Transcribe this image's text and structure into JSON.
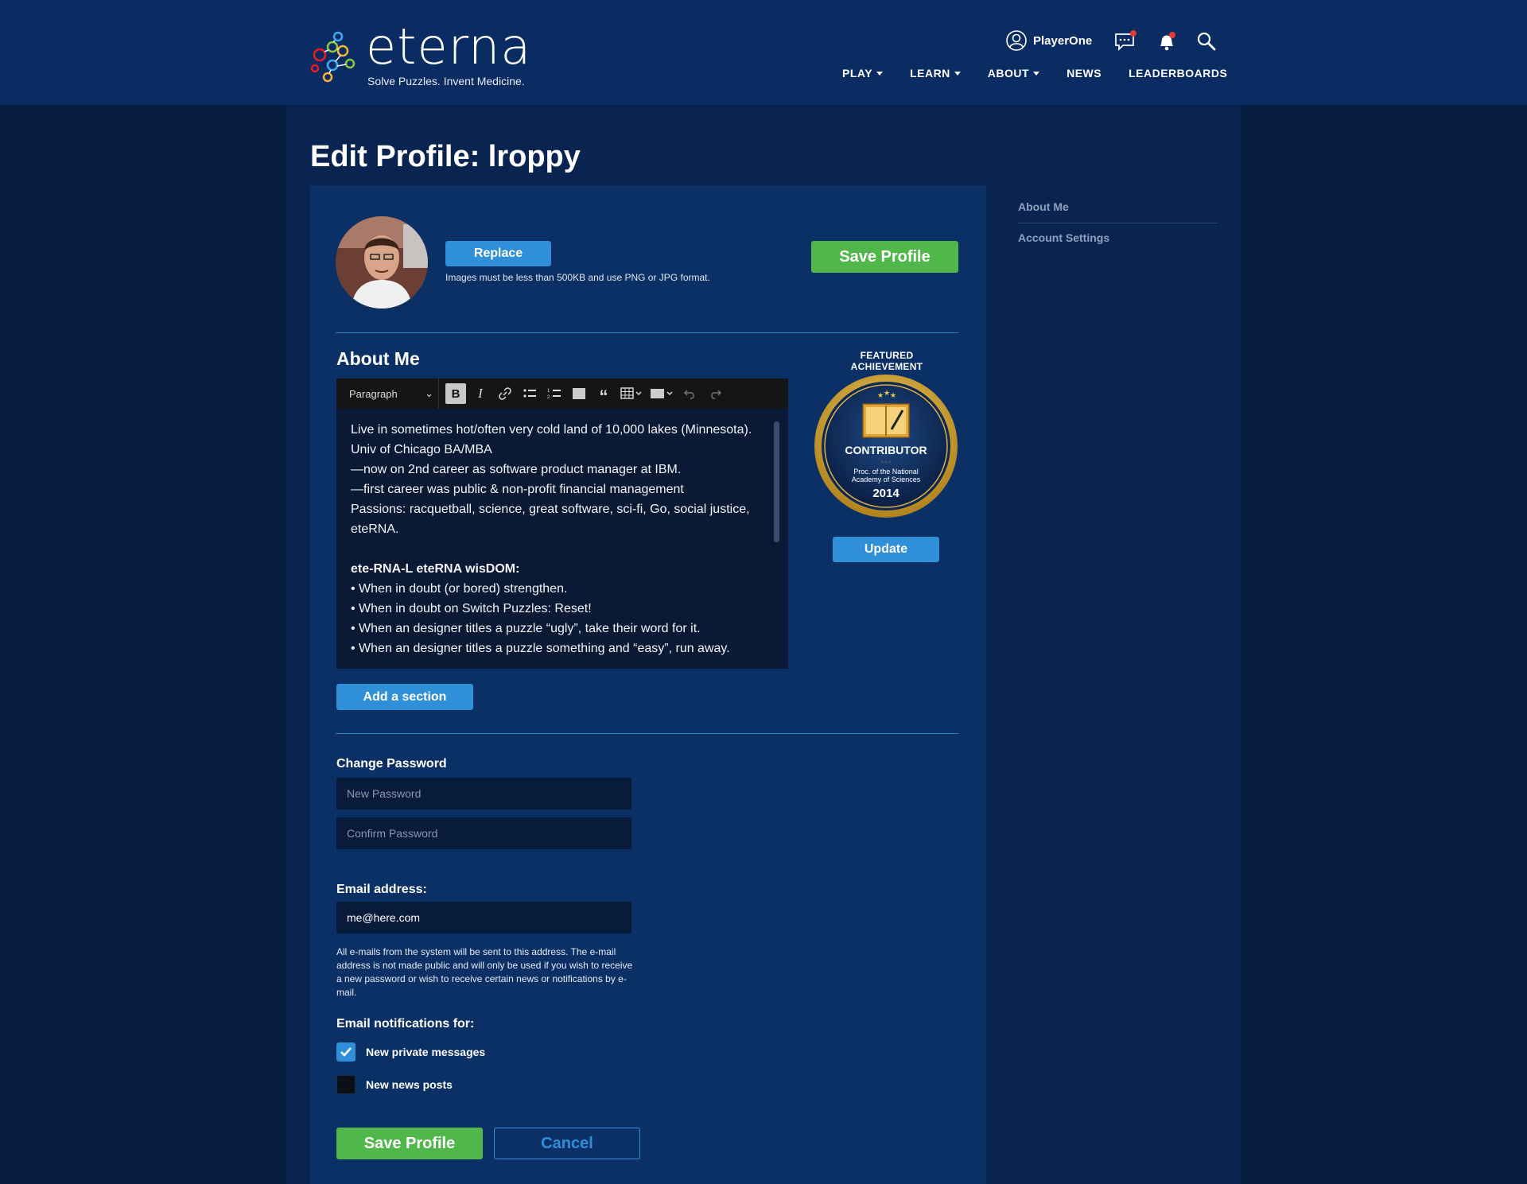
{
  "header": {
    "logo_word": "eterna",
    "logo_tagline": "Solve Puzzles. Invent Medicine.",
    "username": "PlayerOne",
    "nav": [
      {
        "label": "PLAY",
        "dropdown": true
      },
      {
        "label": "LEARN",
        "dropdown": true
      },
      {
        "label": "ABOUT",
        "dropdown": true
      },
      {
        "label": "NEWS",
        "dropdown": false
      },
      {
        "label": "LEADERBOARDS",
        "dropdown": false
      }
    ],
    "icons": [
      "user-icon",
      "chat-icon",
      "bell-icon",
      "search-icon"
    ]
  },
  "page": {
    "title": "Edit Profile: lroppy"
  },
  "profile": {
    "replace_label": "Replace",
    "image_note": "Images must be less than 500KB and use PNG or JPG format.",
    "save_label": "Save Profile"
  },
  "about": {
    "title": "About Me",
    "toolbar": {
      "block_format": "Paragraph"
    },
    "lines": [
      "Live in sometimes hot/often very cold land of 10,000 lakes (Minnesota).",
      "Univ of Chicago BA/MBA",
      "—now on 2nd career as software product manager at IBM.",
      "—first career was public & non-profit financial management",
      "Passions: racquetball, science, great software, sci-fi, Go, social justice, eteRNA.",
      "",
      "ete-RNA-L eteRNA wisDOM:",
      "• When in doubt (or bored) strengthen.",
      "• When in doubt on Switch Puzzles: Reset!",
      "• When an designer titles a puzzle “ugly”, take their word for it.",
      "• When an designer titles a puzzle something and “easy”, run away."
    ],
    "add_section_label": "Add a section"
  },
  "achievement": {
    "label": "FEATURED ACHIEVEMENT",
    "badge_title": "CONTRIBUTOR",
    "badge_line1": "Proc. of the National",
    "badge_line2": "Academy of Sciences",
    "badge_year": "2014",
    "update_label": "Update"
  },
  "password": {
    "label": "Change Password",
    "new_placeholder": "New Password",
    "confirm_placeholder": "Confirm Password"
  },
  "email": {
    "label": "Email address:",
    "value": "me@here.com",
    "note": "All e-mails from the system will be sent to this address. The e-mail address is not made public and will only be used if you wish to receive a new password or wish to receive certain news or notifications by e-mail."
  },
  "notifications": {
    "label": "Email notifications for:",
    "options": [
      {
        "label": "New private messages",
        "checked": true
      },
      {
        "label": "New news posts",
        "checked": false
      }
    ]
  },
  "footer_actions": {
    "save_label": "Save Profile",
    "cancel_label": "Cancel"
  },
  "sidebar": {
    "links": [
      "About Me",
      "Account Settings"
    ]
  },
  "colors": {
    "header_bg": "#0a2c63",
    "card_bg": "#0b3066",
    "accent_blue": "#2f8fd8",
    "accent_green": "#50b84a",
    "notification_dot": "#e53935"
  }
}
